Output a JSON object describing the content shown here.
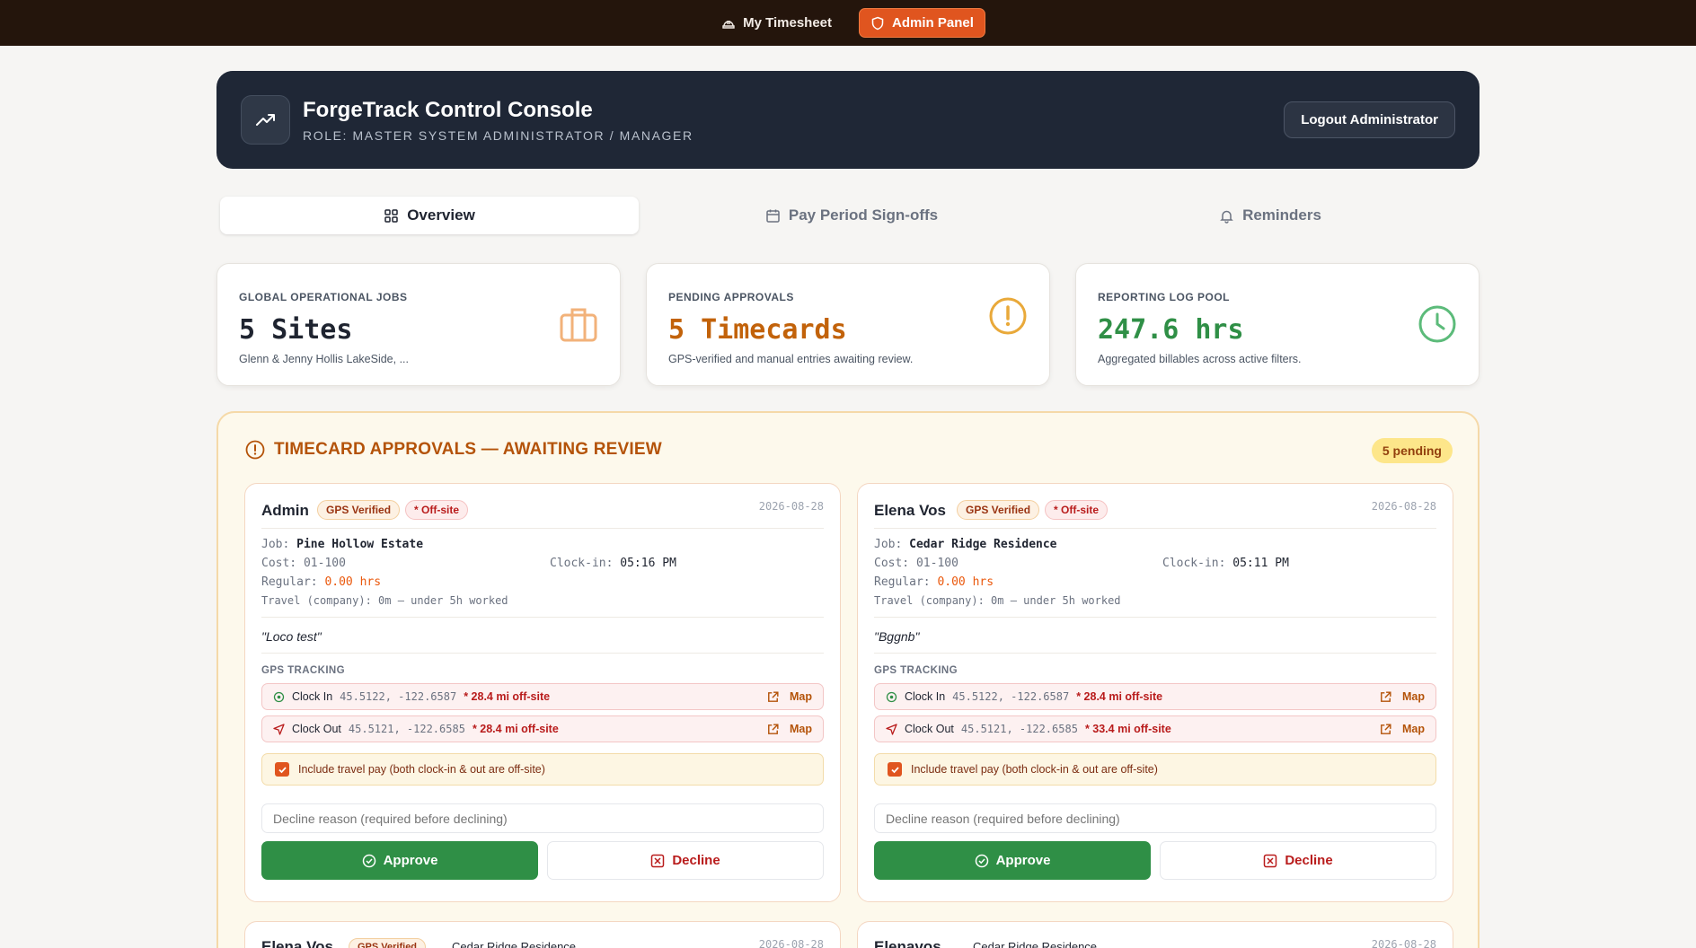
{
  "nav": {
    "timesheet_label": "My Timesheet",
    "admin_label": "Admin Panel"
  },
  "header": {
    "title": "ForgeTrack Control Console",
    "role": "ROLE: MASTER SYSTEM ADMINISTRATOR / MANAGER",
    "logout_label": "Logout Administrator"
  },
  "tabs": [
    {
      "label": "Overview",
      "icon": "grid-icon",
      "active": true
    },
    {
      "label": "Pay Period Sign-offs",
      "icon": "calendar-icon",
      "active": false
    },
    {
      "label": "Reminders",
      "icon": "bell-icon",
      "active": false
    }
  ],
  "stats": [
    {
      "label": "GLOBAL OPERATIONAL JOBS",
      "value": "5 Sites",
      "desc": "Glenn & Jenny Hollis LakeSide, ...",
      "icon": "briefcase-icon",
      "color": "#1f2430",
      "icon_color": "#f2b27a"
    },
    {
      "label": "PENDING APPROVALS",
      "value": "5 Timecards",
      "desc": "GPS-verified and manual entries awaiting review.",
      "icon": "alert-circle-icon",
      "color": "#c2620a",
      "icon_color": "#e9a93a"
    },
    {
      "label": "REPORTING LOG POOL",
      "value": "247.6 hrs",
      "desc": "Aggregated billables across active filters.",
      "icon": "clock-icon",
      "color": "#2f8f46",
      "icon_color": "#5cbb7a"
    }
  ],
  "approvals": {
    "title": "TIMECARD APPROVALS — AWAITING REVIEW",
    "pending": "5 pending",
    "cards": [
      {
        "name": "Admin",
        "gps_badge": "GPS Verified",
        "off_badge": "* Off-site",
        "date": "2026-08-28",
        "job_label": "Job:",
        "job": "Pine Hollow Estate",
        "cost_label": "Cost:",
        "cost": "01-100",
        "clockin_label": "Clock-in:",
        "clockin": "05:16 PM",
        "regular_label": "Regular:",
        "regular": "0.00 hrs",
        "travel_line": "Travel (company): 0m — under 5h worked",
        "note": "\"Loco test\"",
        "gps_label": "GPS TRACKING",
        "gps_in": {
          "label": "Clock In",
          "coords": "45.5122, -122.6587",
          "off": "* 28.4 mi off-site",
          "map": "Map"
        },
        "gps_out": {
          "label": "Clock Out",
          "coords": "45.5121, -122.6585",
          "off": "* 28.4 mi off-site",
          "map": "Map"
        },
        "travel_pay": "Include travel pay (both clock-in & out are off-site)",
        "reason_placeholder": "Decline reason (required before declining)",
        "approve": "Approve",
        "decline": "Decline"
      },
      {
        "name": "Elena Vos",
        "gps_badge": "GPS Verified",
        "off_badge": "* Off-site",
        "date": "2026-08-28",
        "job_label": "Job:",
        "job": "Cedar Ridge Residence",
        "cost_label": "Cost:",
        "cost": "01-100",
        "clockin_label": "Clock-in:",
        "clockin": "05:11 PM",
        "regular_label": "Regular:",
        "regular": "0.00 hrs",
        "travel_line": "Travel (company): 0m — under 5h worked",
        "note": "\"Bggnb\"",
        "gps_label": "GPS TRACKING",
        "gps_in": {
          "label": "Clock In",
          "coords": "45.5122, -122.6587",
          "off": "* 28.4 mi off-site",
          "map": "Map"
        },
        "gps_out": {
          "label": "Clock Out",
          "coords": "45.5121, -122.6585",
          "off": "* 33.4 mi off-site",
          "map": "Map"
        },
        "travel_pay": "Include travel pay (both clock-in & out are off-site)",
        "reason_placeholder": "Decline reason (required before declining)",
        "approve": "Approve",
        "decline": "Decline"
      }
    ],
    "peek_cards": [
      {
        "name": "Elena Vos",
        "badge": "GPS Verified",
        "job": "Cedar Ridge Residence",
        "date": "2026-08-28"
      },
      {
        "name": "Elenavos",
        "job": "Cedar Ridge Residence",
        "date": "2026-08-28"
      }
    ]
  }
}
